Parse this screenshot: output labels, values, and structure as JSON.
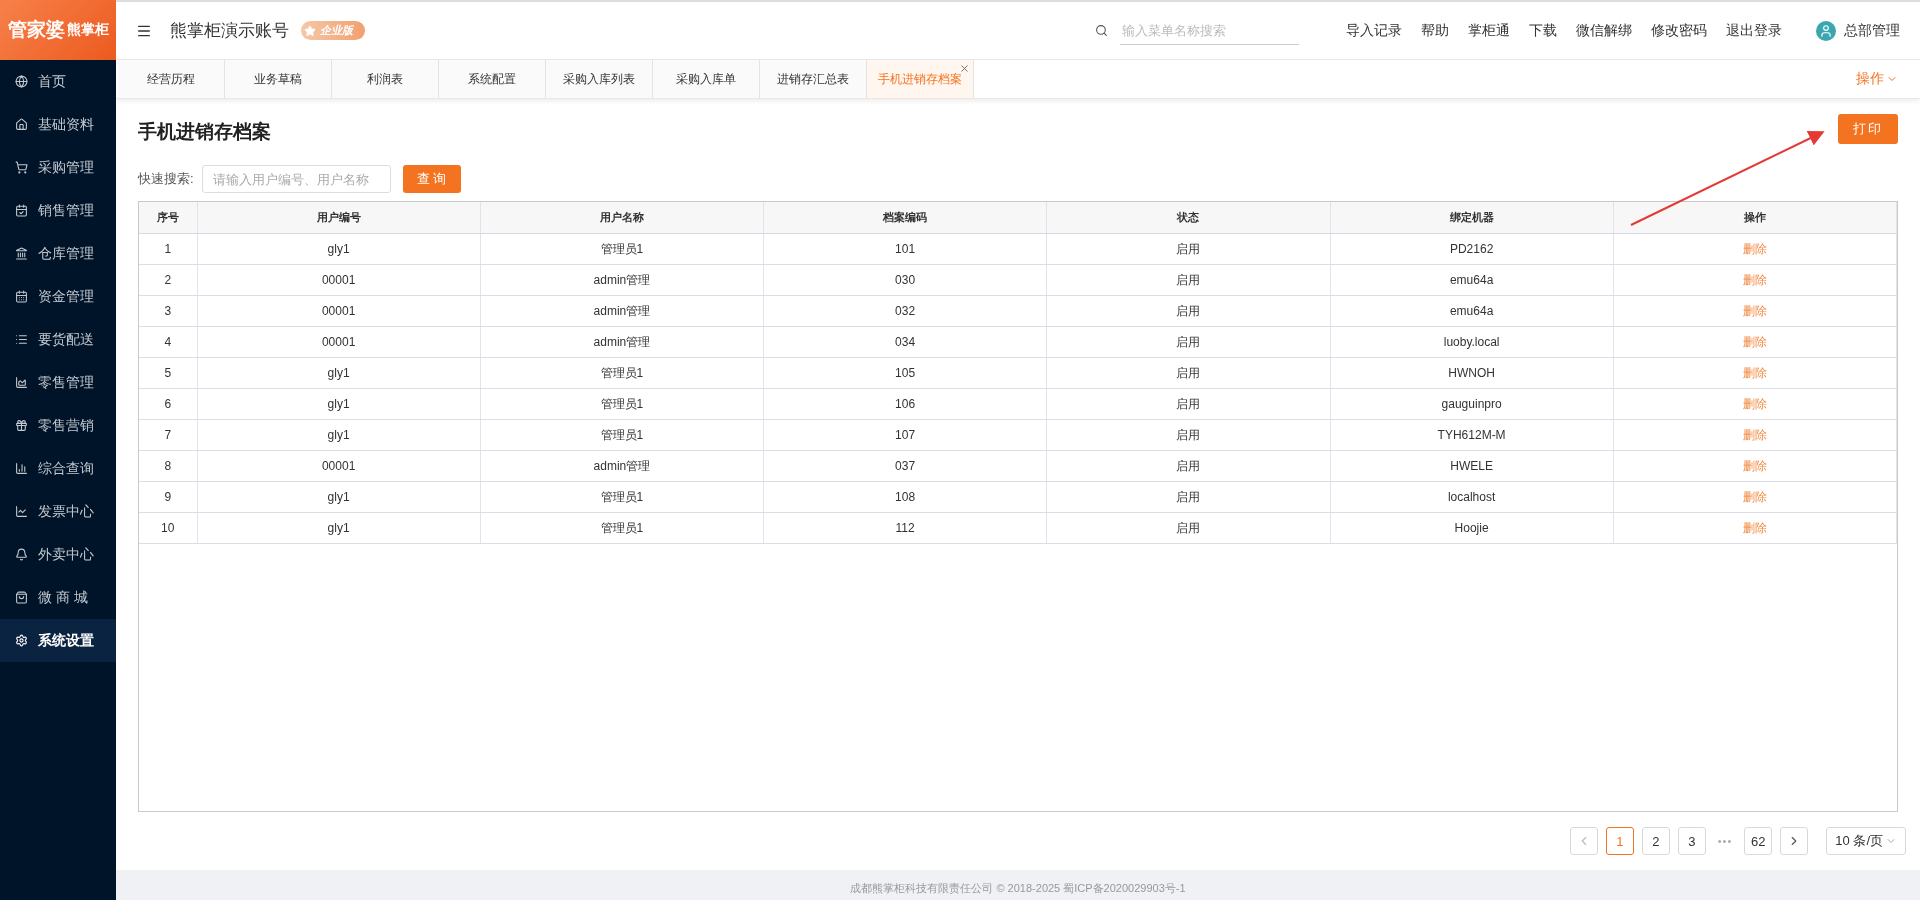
{
  "logo": {
    "brand": "管家婆",
    "product": "熊掌柜"
  },
  "header": {
    "account": "熊掌柜演示账号",
    "edition": "企业版",
    "search": {
      "placeholder": "输入菜单名称搜索"
    },
    "links": [
      "导入记录",
      "帮助",
      "掌柜通",
      "下载",
      "微信解绑",
      "修改密码",
      "退出登录"
    ],
    "user": "总部管理"
  },
  "sidebar": {
    "items": [
      {
        "label": "首页",
        "selected": false
      },
      {
        "label": "基础资料",
        "selected": false
      },
      {
        "label": "采购管理",
        "selected": false
      },
      {
        "label": "销售管理",
        "selected": false
      },
      {
        "label": "仓库管理",
        "selected": false
      },
      {
        "label": "资金管理",
        "selected": false
      },
      {
        "label": "要货配送",
        "selected": false
      },
      {
        "label": "零售管理",
        "selected": false
      },
      {
        "label": "零售营销",
        "selected": false
      },
      {
        "label": "综合查询",
        "selected": false
      },
      {
        "label": "发票中心",
        "selected": false
      },
      {
        "label": "外卖中心",
        "selected": false
      },
      {
        "label": "微 商 城",
        "selected": false
      },
      {
        "label": "系统设置",
        "selected": true
      }
    ]
  },
  "tabs": [
    {
      "label": "经营历程",
      "selected": false
    },
    {
      "label": "业务草稿",
      "selected": false
    },
    {
      "label": "利润表",
      "selected": false
    },
    {
      "label": "系统配置",
      "selected": false
    },
    {
      "label": "采购入库列表",
      "selected": false
    },
    {
      "label": "采购入库单",
      "selected": false
    },
    {
      "label": "进销存汇总表",
      "selected": false
    },
    {
      "label": "手机进销存档案",
      "selected": true
    }
  ],
  "tab_actions": "操作",
  "page": {
    "title": "手机进销存档案",
    "print_button": "打印",
    "search_label": "快速搜索:",
    "search": {
      "placeholder": "请输入用户编号、用户名称"
    },
    "query_button": "查 询"
  },
  "table": {
    "columns": [
      "序号",
      "用户编号",
      "用户名称",
      "档案编码",
      "状态",
      "绑定机器",
      "操作"
    ],
    "rows": [
      [
        "1",
        "gly1",
        "管理员1",
        "101",
        "启用",
        "PD2162",
        "删除"
      ],
      [
        "2",
        "00001",
        "admin管理",
        "030",
        "启用",
        "emu64a",
        "删除"
      ],
      [
        "3",
        "00001",
        "admin管理",
        "032",
        "启用",
        "emu64a",
        "删除"
      ],
      [
        "4",
        "00001",
        "admin管理",
        "034",
        "启用",
        "luoby.local",
        "删除"
      ],
      [
        "5",
        "gly1",
        "管理员1",
        "105",
        "启用",
        "HWNOH",
        "删除"
      ],
      [
        "6",
        "gly1",
        "管理员1",
        "106",
        "启用",
        "gauguinpro",
        "删除"
      ],
      [
        "7",
        "gly1",
        "管理员1",
        "107",
        "启用",
        "TYH612M-M",
        "删除"
      ],
      [
        "8",
        "00001",
        "admin管理",
        "037",
        "启用",
        "HWELE",
        "删除"
      ],
      [
        "9",
        "gly1",
        "管理员1",
        "108",
        "启用",
        "localhost",
        "删除"
      ],
      [
        "10",
        "gly1",
        "管理员1",
        "112",
        "启用",
        "Hoojie",
        "删除"
      ]
    ]
  },
  "pagination": {
    "pages": [
      {
        "label": "1",
        "selected": true
      },
      {
        "label": "2",
        "selected": false
      },
      {
        "label": "3",
        "selected": false
      },
      {
        "label": "62",
        "selected": false
      }
    ],
    "ellipsis": "•••",
    "page_size": "10 条/页"
  },
  "footer": "成都熊掌柜科技有限责任公司 © 2018-2025 蜀ICP备2020029903号-1"
}
